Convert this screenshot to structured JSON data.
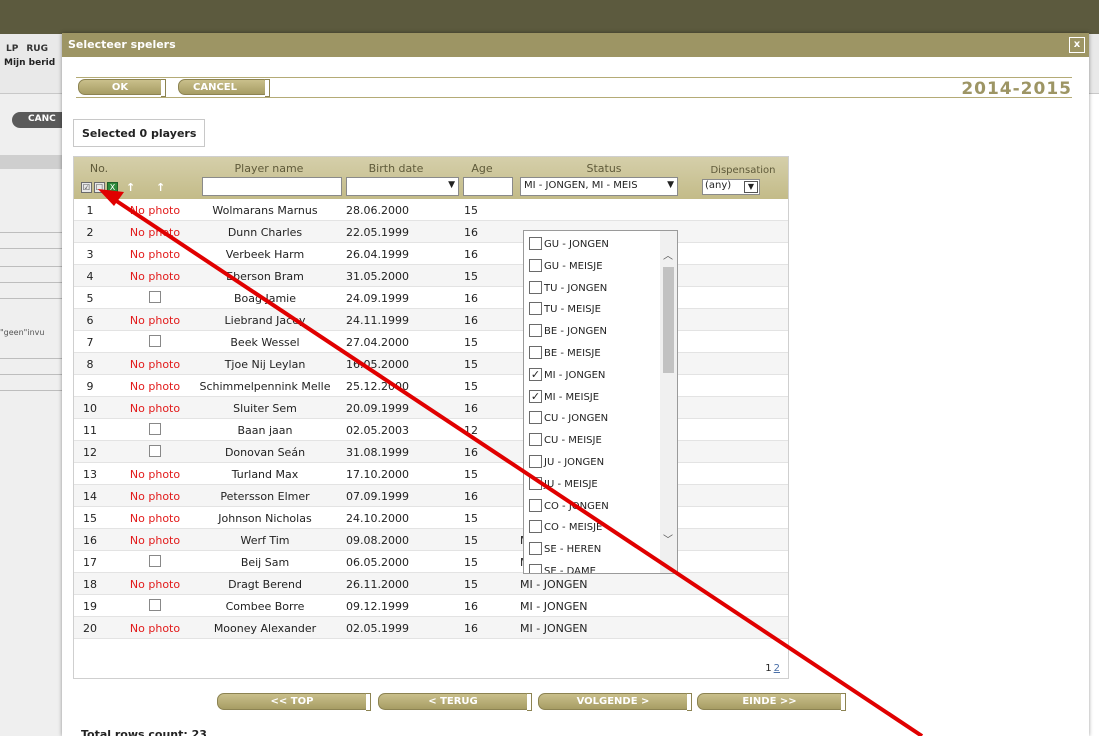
{
  "background": {
    "menu": [
      "LP",
      "RUG"
    ],
    "mijn": "Mijn berid",
    "cancel": "CANC",
    "geen": "\"geen\"invu"
  },
  "modal": {
    "title": "Selecteer spelers",
    "close": "x",
    "ok": "OK",
    "cancel": "CANCEL",
    "season": "2014-2015",
    "selected": "Selected 0 players"
  },
  "grid": {
    "headers": {
      "no": "No.",
      "name": "Player name",
      "birth": "Birth date",
      "age": "Age",
      "status": "Status",
      "dispensation": "Dispensation"
    },
    "filters": {
      "status_value": "MI - JONGEN, MI - MEIS",
      "dispensation_value": "(any)"
    },
    "rows": [
      {
        "no": "1",
        "photo": "No photo",
        "name": "Wolmarans Marnus",
        "birth": "28.06.2000",
        "age": "15",
        "status": ""
      },
      {
        "no": "2",
        "photo": "No photo",
        "name": "Dunn Charles",
        "birth": "22.05.1999",
        "age": "16",
        "status": ""
      },
      {
        "no": "3",
        "photo": "No photo",
        "name": "Verbeek Harm",
        "birth": "26.04.1999",
        "age": "16",
        "status": ""
      },
      {
        "no": "4",
        "photo": "No photo",
        "name": "Eberson Bram",
        "birth": "31.05.2000",
        "age": "15",
        "status": ""
      },
      {
        "no": "5",
        "photo": "",
        "name": "Boag Jamie",
        "birth": "24.09.1999",
        "age": "16",
        "status": ""
      },
      {
        "no": "6",
        "photo": "No photo",
        "name": "Liebrand Jacey",
        "birth": "24.11.1999",
        "age": "16",
        "status": ""
      },
      {
        "no": "7",
        "photo": "",
        "name": "Beek Wessel",
        "birth": "27.04.2000",
        "age": "15",
        "status": ""
      },
      {
        "no": "8",
        "photo": "No photo",
        "name": "Tjoe Nij Leylan",
        "birth": "16.05.2000",
        "age": "15",
        "status": ""
      },
      {
        "no": "9",
        "photo": "No photo",
        "name": "Schimmelpennink Melle",
        "birth": "25.12.2000",
        "age": "15",
        "status": ""
      },
      {
        "no": "10",
        "photo": "No photo",
        "name": "Sluiter Sem",
        "birth": "20.09.1999",
        "age": "16",
        "status": ""
      },
      {
        "no": "11",
        "photo": "",
        "name": "Baan jaan",
        "birth": "02.05.2003",
        "age": "12",
        "status": ""
      },
      {
        "no": "12",
        "photo": "",
        "name": "Donovan Seán",
        "birth": "31.08.1999",
        "age": "16",
        "status": ""
      },
      {
        "no": "13",
        "photo": "No photo",
        "name": "Turland Max",
        "birth": "17.10.2000",
        "age": "15",
        "status": ""
      },
      {
        "no": "14",
        "photo": "No photo",
        "name": "Petersson Elmer",
        "birth": "07.09.1999",
        "age": "16",
        "status": ""
      },
      {
        "no": "15",
        "photo": "No photo",
        "name": "Johnson Nicholas",
        "birth": "24.10.2000",
        "age": "15",
        "status": ""
      },
      {
        "no": "16",
        "photo": "No photo",
        "name": "Werf Tim",
        "birth": "09.08.2000",
        "age": "15",
        "status": "MI - JONGEN"
      },
      {
        "no": "17",
        "photo": "",
        "name": "Beij Sam",
        "birth": "06.05.2000",
        "age": "15",
        "status": "MI - JONGEN"
      },
      {
        "no": "18",
        "photo": "No photo",
        "name": "Dragt Berend",
        "birth": "26.11.2000",
        "age": "15",
        "status": "MI - JONGEN"
      },
      {
        "no": "19",
        "photo": "",
        "name": "Combee Borre",
        "birth": "09.12.1999",
        "age": "16",
        "status": "MI - JONGEN"
      },
      {
        "no": "20",
        "photo": "No photo",
        "name": "Mooney Alexander",
        "birth": "02.05.1999",
        "age": "16",
        "status": "MI - JONGEN"
      }
    ],
    "pager": {
      "current": "1",
      "next": "2"
    }
  },
  "status_options": [
    {
      "label": "GU - JONGEN",
      "checked": false
    },
    {
      "label": "GU - MEISJE",
      "checked": false
    },
    {
      "label": "TU - JONGEN",
      "checked": false
    },
    {
      "label": "TU - MEISJE",
      "checked": false
    },
    {
      "label": "BE - JONGEN",
      "checked": false
    },
    {
      "label": "BE - MEISJE",
      "checked": false
    },
    {
      "label": "MI - JONGEN",
      "checked": true
    },
    {
      "label": "MI - MEISJE",
      "checked": true
    },
    {
      "label": "CU - JONGEN",
      "checked": false
    },
    {
      "label": "CU - MEISJE",
      "checked": false
    },
    {
      "label": "JU - JONGEN",
      "checked": false
    },
    {
      "label": "JU - MEISJE",
      "checked": false
    },
    {
      "label": "CO - JONGEN",
      "checked": false
    },
    {
      "label": "CO - MEISJE",
      "checked": false
    },
    {
      "label": "SE - HEREN",
      "checked": false
    },
    {
      "label": "SE - DAME",
      "checked": false
    }
  ],
  "footer": {
    "total": "Total rows count: 23",
    "top": "<< TOP",
    "back": "< TERUG",
    "next": "VOLGENDE >",
    "end": "EINDE >>"
  },
  "colors": {
    "accent": "#9d9564",
    "no_photo": "#e21b1b",
    "arrow": "#e00000"
  },
  "icons": [
    "check-all-icon",
    "uncheck-all-icon",
    "excel-icon",
    "sort-up-icon",
    "close-icon",
    "scroll-up-icon",
    "scroll-down-icon"
  ]
}
